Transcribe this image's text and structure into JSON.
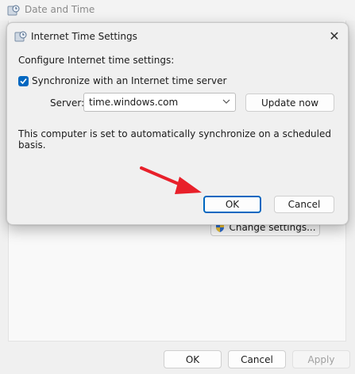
{
  "parent_window": {
    "title": "Date and Time",
    "change_settings_label": "Change settings...",
    "buttons": {
      "ok": "OK",
      "cancel": "Cancel",
      "apply": "Apply"
    }
  },
  "dialog": {
    "title": "Internet Time Settings",
    "section_label": "Configure Internet time settings:",
    "sync_label": "Synchronize with an Internet time server",
    "sync_checked": true,
    "server_label": "Server:",
    "server_value": "time.windows.com",
    "update_now_label": "Update now",
    "status_text": "This computer is set to automatically synchronize on a scheduled basis.",
    "ok_label": "OK",
    "cancel_label": "Cancel",
    "close_glyph": "✕"
  },
  "colors": {
    "accent": "#0067c0",
    "annotation_arrow": "#e8202a"
  },
  "icons": {
    "window_icon": "date-time-clock-icon",
    "shield": "uac-shield-icon",
    "chevron": "chevron-down-icon"
  }
}
